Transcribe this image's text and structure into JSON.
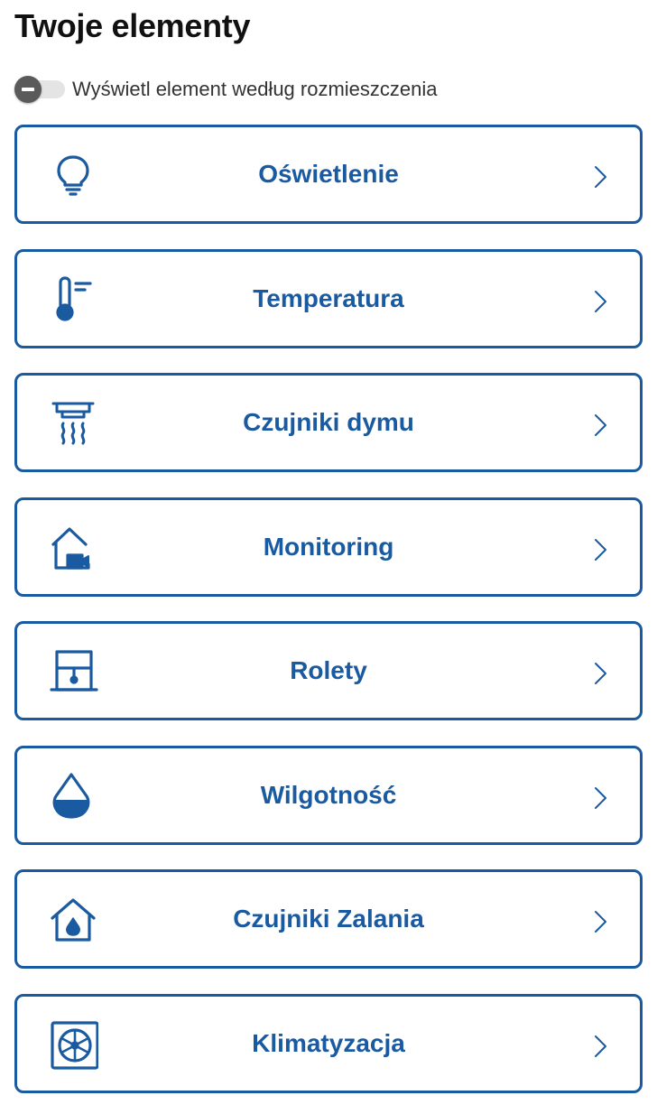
{
  "header": {
    "title": "Twoje elementy"
  },
  "layout_toggle": {
    "label": "Wyświetl element według rozmieszczenia",
    "state": "off"
  },
  "colors": {
    "accent": "#1a5aa0",
    "title": "#111111",
    "toggle_knob": "#5a5a5a"
  },
  "items": [
    {
      "label": "Oświetlenie",
      "icon": "lightbulb-icon"
    },
    {
      "label": "Temperatura",
      "icon": "thermometer-icon"
    },
    {
      "label": "Czujniki dymu",
      "icon": "smoke-detector-icon"
    },
    {
      "label": "Monitoring",
      "icon": "house-camera-icon"
    },
    {
      "label": "Rolety",
      "icon": "window-blinds-icon"
    },
    {
      "label": "Wilgotność",
      "icon": "water-drop-icon"
    },
    {
      "label": "Czujniki Zalania",
      "icon": "house-water-icon"
    },
    {
      "label": "Klimatyzacja",
      "icon": "air-conditioner-icon"
    }
  ]
}
